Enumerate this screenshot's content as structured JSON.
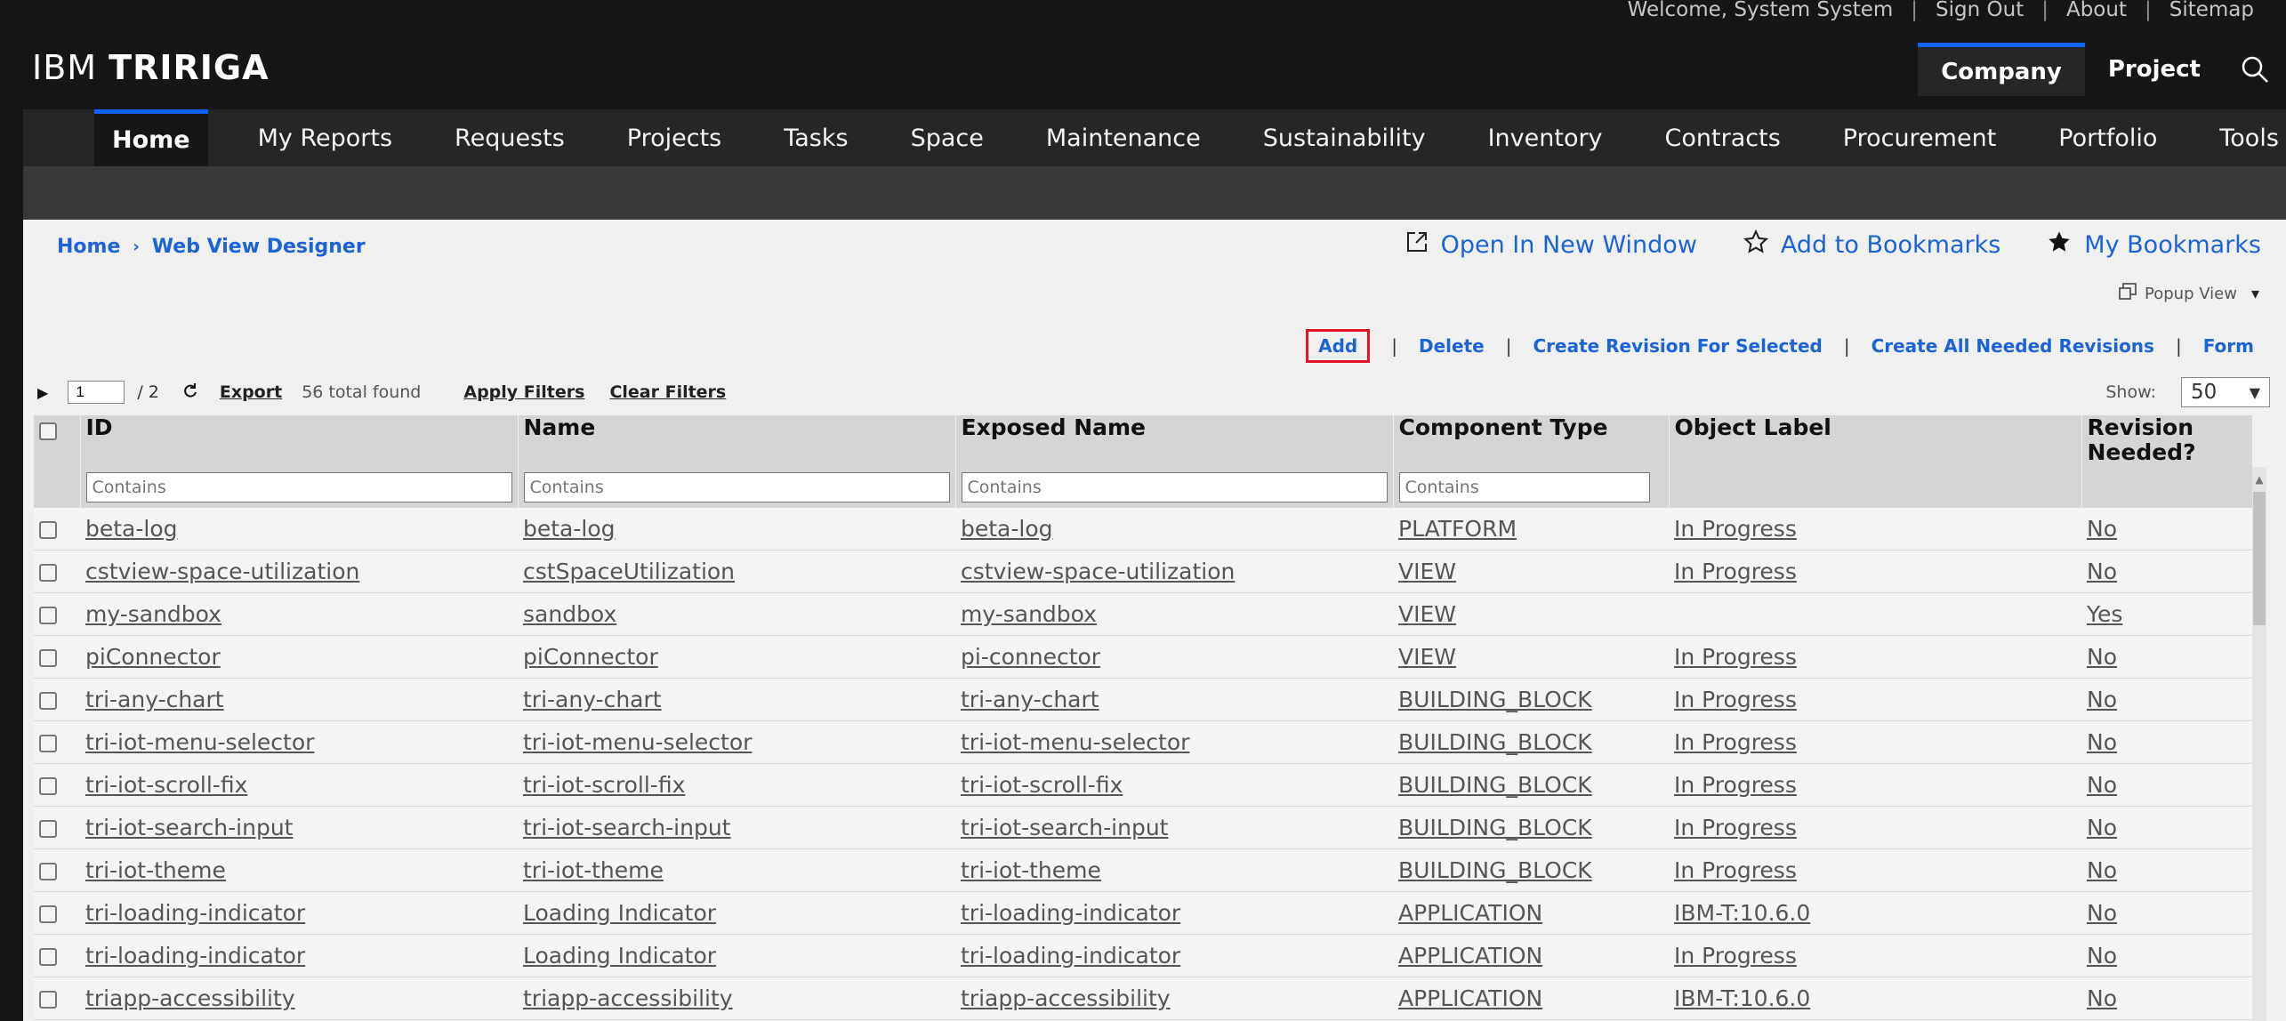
{
  "utility": {
    "welcome": "Welcome, System System",
    "sign_out": "Sign Out",
    "about": "About",
    "sitemap": "Sitemap"
  },
  "brand": {
    "prefix": "IBM",
    "name": "TRIRIGA"
  },
  "masthead": {
    "tabs": [
      {
        "label": "Company",
        "active": true
      },
      {
        "label": "Project",
        "active": false
      }
    ],
    "search_icon": "search-icon"
  },
  "nav": {
    "items": [
      {
        "label": "Home",
        "active": true
      },
      {
        "label": "My Reports"
      },
      {
        "label": "Requests"
      },
      {
        "label": "Projects"
      },
      {
        "label": "Tasks"
      },
      {
        "label": "Space"
      },
      {
        "label": "Maintenance"
      },
      {
        "label": "Sustainability"
      },
      {
        "label": "Inventory"
      },
      {
        "label": "Contracts"
      },
      {
        "label": "Procurement"
      },
      {
        "label": "Portfolio"
      },
      {
        "label": "Tools"
      }
    ]
  },
  "breadcrumb": {
    "home": "Home",
    "current": "Web View Designer"
  },
  "toplinks": {
    "open_new_window": "Open In New Window",
    "add_bookmarks": "Add to Bookmarks",
    "my_bookmarks": "My Bookmarks"
  },
  "popup_view": "Popup View",
  "actions": {
    "add": "Add",
    "delete": "Delete",
    "create_revision_selected": "Create Revision For Selected",
    "create_all_revisions": "Create All Needed Revisions",
    "form": "Form"
  },
  "gridbar": {
    "page_value": "1",
    "page_total": "/ 2",
    "export": "Export",
    "total_found": "56 total found",
    "apply_filters": "Apply Filters",
    "clear_filters": "Clear Filters",
    "show_label": "Show:",
    "show_value": "50"
  },
  "table": {
    "headers": {
      "id": "ID",
      "name": "Name",
      "exposed_name": "Exposed Name",
      "component_type": "Component Type",
      "object_label": "Object Label",
      "revision_needed": "Revision Needed?"
    },
    "filter_placeholder": "Contains",
    "rows": [
      [
        "beta-log",
        "beta-log",
        "beta-log",
        "PLATFORM",
        "In Progress",
        "No"
      ],
      [
        "cstview-space-utilization",
        "cstSpaceUtilization",
        "cstview-space-utilization",
        "VIEW",
        "In Progress",
        "No"
      ],
      [
        "my-sandbox",
        "sandbox",
        "my-sandbox",
        "VIEW",
        "",
        "Yes"
      ],
      [
        "piConnector",
        "piConnector",
        "pi-connector",
        "VIEW",
        "In Progress",
        "No"
      ],
      [
        "tri-any-chart",
        "tri-any-chart",
        "tri-any-chart",
        "BUILDING_BLOCK",
        "In Progress",
        "No"
      ],
      [
        "tri-iot-menu-selector",
        "tri-iot-menu-selector",
        "tri-iot-menu-selector",
        "BUILDING_BLOCK",
        "In Progress",
        "No"
      ],
      [
        "tri-iot-scroll-fix",
        "tri-iot-scroll-fix",
        "tri-iot-scroll-fix",
        "BUILDING_BLOCK",
        "In Progress",
        "No"
      ],
      [
        "tri-iot-search-input",
        "tri-iot-search-input",
        "tri-iot-search-input",
        "BUILDING_BLOCK",
        "In Progress",
        "No"
      ],
      [
        "tri-iot-theme",
        "tri-iot-theme",
        "tri-iot-theme",
        "BUILDING_BLOCK",
        "In Progress",
        "No"
      ],
      [
        "tri-loading-indicator",
        "Loading Indicator",
        "tri-loading-indicator",
        "APPLICATION",
        "IBM-T:10.6.0",
        "No"
      ],
      [
        "tri-loading-indicator",
        "Loading Indicator",
        "tri-loading-indicator",
        "APPLICATION",
        "In Progress",
        "No"
      ],
      [
        "triapp-accessibility",
        "triapp-accessibility",
        "triapp-accessibility",
        "APPLICATION",
        "IBM-T:10.6.0",
        "No"
      ]
    ]
  },
  "colors": {
    "accent": "#0f62fe",
    "link": "#1c63d6",
    "highlight_box": "#e0142a"
  }
}
